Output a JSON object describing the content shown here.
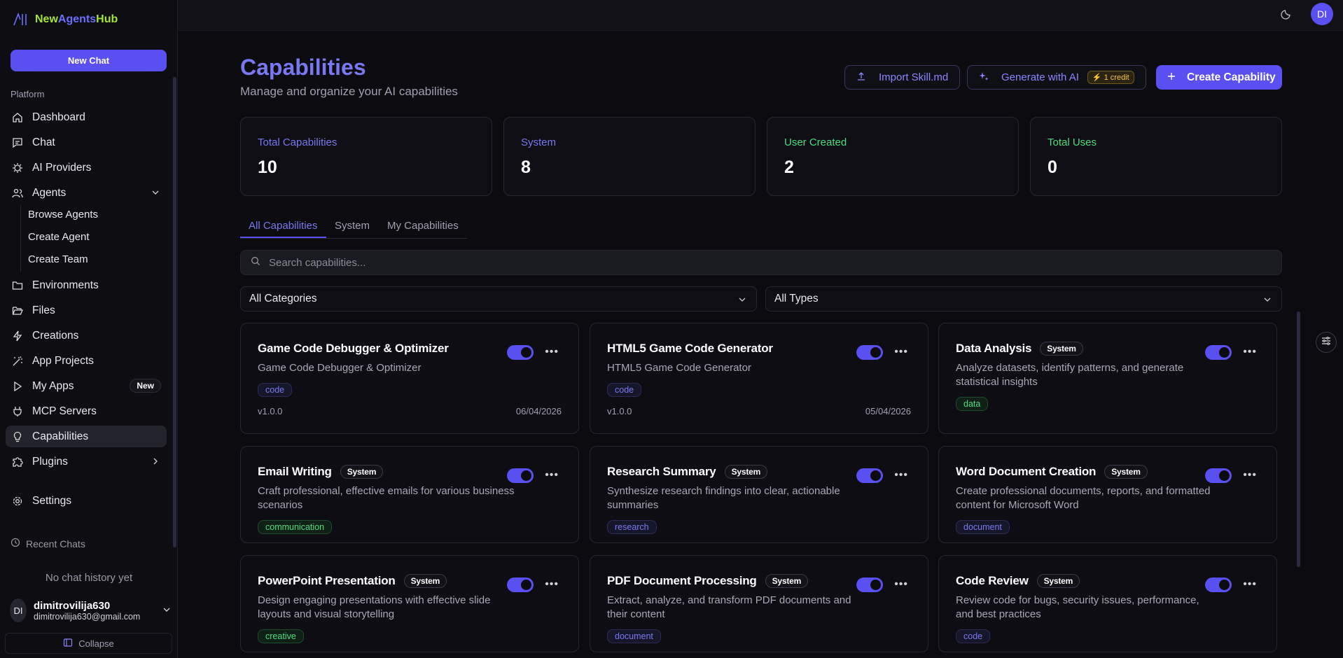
{
  "brand": {
    "part1": "New",
    "part2": "Agents",
    "part3": "Hub"
  },
  "sidebar": {
    "new_chat": "New Chat",
    "section": "Platform",
    "items": [
      {
        "label": "Dashboard",
        "icon": "home-icon"
      },
      {
        "label": "Chat",
        "icon": "chat-icon"
      },
      {
        "label": "AI Providers",
        "icon": "chip-icon"
      },
      {
        "label": "Agents",
        "icon": "users-icon"
      },
      {
        "label": "Environments",
        "icon": "folder-icon"
      },
      {
        "label": "Files",
        "icon": "folder-open-icon"
      },
      {
        "label": "Creations",
        "icon": "bolt-icon"
      },
      {
        "label": "App Projects",
        "icon": "wand-icon"
      },
      {
        "label": "My Apps",
        "icon": "play-icon",
        "badge": "New"
      },
      {
        "label": "MCP Servers",
        "icon": "plug-icon"
      },
      {
        "label": "Capabilities",
        "icon": "bulb-icon"
      },
      {
        "label": "Plugins",
        "icon": "puzzle-icon"
      },
      {
        "label": "Settings",
        "icon": "gear-icon"
      }
    ],
    "agents_sub": [
      "Browse Agents",
      "Create Agent",
      "Create Team"
    ],
    "recent_chats": "Recent Chats",
    "no_history": "No chat history yet",
    "user": {
      "initials": "DI",
      "name": "dimitrovilija630",
      "email": "dimitrovilija630@gmail.com"
    },
    "collapse": "Collapse"
  },
  "topbar": {
    "avatar": "DI"
  },
  "header": {
    "title": "Capabilities",
    "subtitle": "Manage and organize your AI capabilities",
    "import_label": "Import Skill.md",
    "generate_label": "Generate with AI",
    "credit_label": "1 credit",
    "create_label": "Create Capability"
  },
  "stats": [
    {
      "label": "Total Capabilities",
      "value": "10",
      "color": "#7a78f0"
    },
    {
      "label": "System",
      "value": "8",
      "color": "#7a78f0"
    },
    {
      "label": "User Created",
      "value": "2",
      "color": "#4ade80"
    },
    {
      "label": "Total Uses",
      "value": "0",
      "color": "#4ade80"
    }
  ],
  "tabs": [
    "All Capabilities",
    "System",
    "My Capabilities"
  ],
  "search": {
    "placeholder": "Search capabilities..."
  },
  "filters": {
    "category": "All Categories",
    "type": "All Types"
  },
  "cards": [
    {
      "title": "Game Code Debugger & Optimizer",
      "badge": "",
      "desc": "Game Code Debugger & Optimizer",
      "tag": "code",
      "version": "v1.0.0",
      "date": "06/04/2026"
    },
    {
      "title": "HTML5 Game Code Generator",
      "badge": "",
      "desc": "HTML5 Game Code Generator",
      "tag": "code",
      "version": "v1.0.0",
      "date": "05/04/2026"
    },
    {
      "title": "Data Analysis",
      "badge": "System",
      "desc": "Analyze datasets, identify patterns, and generate statistical insights",
      "tag": "data"
    },
    {
      "title": "Email Writing",
      "badge": "System",
      "desc": "Craft professional, effective emails for various business scenarios",
      "tag": "communication"
    },
    {
      "title": "Research Summary",
      "badge": "System",
      "desc": "Synthesize research findings into clear, actionable summaries",
      "tag": "research"
    },
    {
      "title": "Word Document Creation",
      "badge": "System",
      "desc": "Create professional documents, reports, and formatted content for Microsoft Word",
      "tag": "document"
    },
    {
      "title": "PowerPoint Presentation",
      "badge": "System",
      "desc": "Design engaging presentations with effective slide layouts and visual storytelling",
      "tag": "creative"
    },
    {
      "title": "PDF Document Processing",
      "badge": "System",
      "desc": "Extract, analyze, and transform PDF documents and their content",
      "tag": "document"
    },
    {
      "title": "Code Review",
      "badge": "System",
      "desc": "Review code for bugs, security issues, performance, and best practices",
      "tag": "code"
    }
  ],
  "colors": {
    "accent": "#5a4ff0",
    "green": "#4ade80",
    "background": "#0b0b10"
  }
}
